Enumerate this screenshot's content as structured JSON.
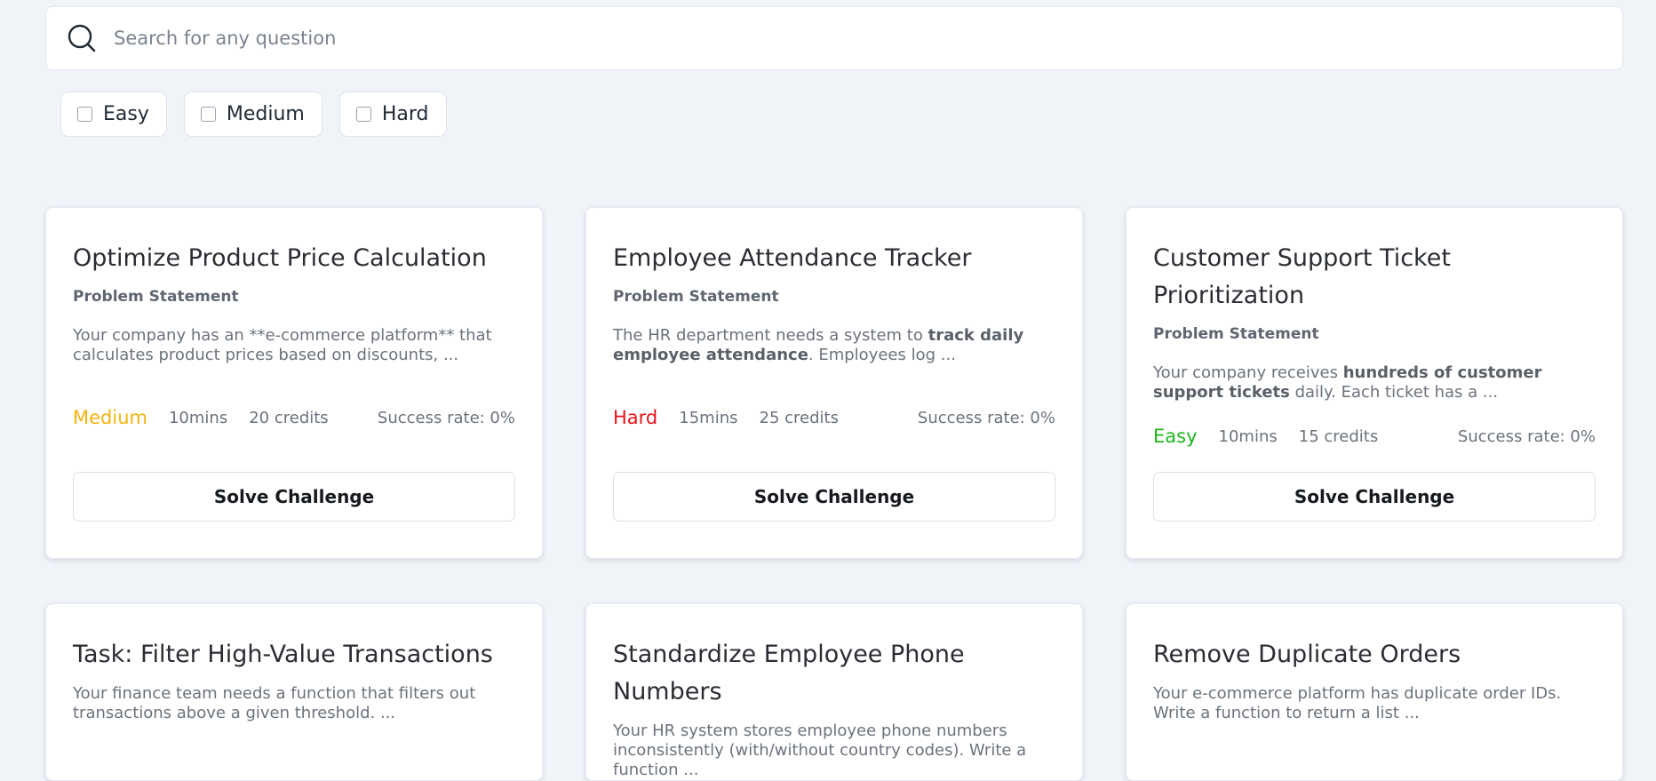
{
  "search": {
    "placeholder": "Search for any question",
    "icon": "search-icon"
  },
  "filters": [
    {
      "label": "Easy",
      "checked": false
    },
    {
      "label": "Medium",
      "checked": false
    },
    {
      "label": "Hard",
      "checked": false
    }
  ],
  "colors": {
    "easy": "#1db71d",
    "medium": "#f5b40f",
    "hard": "#e8141b",
    "background": "#f0f3f8"
  },
  "cards": [
    {
      "title": "Optimize Product Price Calculation",
      "subtitle": "Problem Statement",
      "desc_parts": [
        {
          "text": "Your company has an **e-commerce platform** that calculates product prices based on discounts, ...",
          "bold": false
        }
      ],
      "difficulty": "Medium",
      "duration": "10mins",
      "credits": "20 credits",
      "success_rate": "Success rate: 0%",
      "button": "Solve Challenge"
    },
    {
      "title": "Employee Attendance Tracker",
      "subtitle": "Problem Statement",
      "desc_parts": [
        {
          "text": "The HR department needs a system to ",
          "bold": false
        },
        {
          "text": "track daily employee attendance",
          "bold": true
        },
        {
          "text": ". Employees log ...",
          "bold": false
        }
      ],
      "difficulty": "Hard",
      "duration": "15mins",
      "credits": "25 credits",
      "success_rate": "Success rate: 0%",
      "button": "Solve Challenge"
    },
    {
      "title": "Customer Support Ticket Prioritization",
      "subtitle": "Problem Statement",
      "desc_parts": [
        {
          "text": "Your company receives ",
          "bold": false
        },
        {
          "text": "hundreds of customer support tickets",
          "bold": true
        },
        {
          "text": " daily. Each ticket has a ...",
          "bold": false
        }
      ],
      "difficulty": "Easy",
      "duration": "10mins",
      "credits": "15 credits",
      "success_rate": "Success rate: 0%",
      "button": "Solve Challenge"
    },
    {
      "title": "Task: Filter High-Value Transactions",
      "desc_parts": [
        {
          "text": "Your finance team needs a function that filters out transactions above a given threshold. ...",
          "bold": false
        }
      ]
    },
    {
      "title": "Standardize Employee Phone Numbers",
      "desc_parts": [
        {
          "text": "Your HR system stores employee phone numbers inconsistently (with/without country codes). Write a function ...",
          "bold": false
        }
      ]
    },
    {
      "title": "Remove Duplicate Orders",
      "desc_parts": [
        {
          "text": "Your e-commerce platform has duplicate order IDs. Write a function to return a list ...",
          "bold": false
        }
      ]
    }
  ]
}
